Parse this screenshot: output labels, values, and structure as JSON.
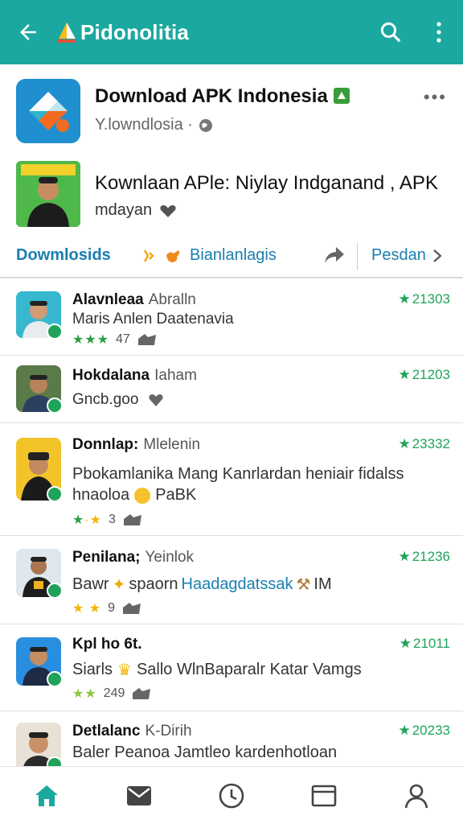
{
  "appbar": {
    "title": "Pidonolitia",
    "back_icon": "arrow-left-icon",
    "search_icon": "search-icon",
    "more_icon": "more-vertical-icon",
    "color": "#1ba8a0"
  },
  "app": {
    "name": "Download APK Indonesia",
    "developer": "Y.lowndlosia ·",
    "more": "•••"
  },
  "featured": {
    "title": "Kownlaan APle: Niylay Indganand , APK",
    "subtitle": "mdayan"
  },
  "tabs": {
    "downloads": "Dowmlosids",
    "middle": "Bianlanlagis",
    "right": "Pesdan"
  },
  "list": [
    {
      "name": "Alavnleaa",
      "sub": "Abralln",
      "score": "21303",
      "desc": "Maris Anlen Daatenavia",
      "rating": "47"
    },
    {
      "name": "Hokdalana",
      "sub": "Iaham",
      "score": "21203",
      "desc": "Gncb.goo",
      "rating": ""
    },
    {
      "name": "Donnlap:",
      "sub": "Mlelenin",
      "score": "23332",
      "desc": "Pbokamlanika Mang Kanrlardan heniair fidalss",
      "desc2": "hnaoloa",
      "desc2_suffix": "PaBK",
      "rating": "3"
    },
    {
      "name": "Penilana;",
      "sub": "Yeinlok",
      "score": "21236",
      "desc_a": "Bawr",
      "desc_b": "spaorn",
      "desc_c": "Haadagdatssak",
      "desc_d": "IM",
      "rating": "9"
    },
    {
      "name": "Kpl ho 6t.",
      "sub": "",
      "score": "21011",
      "desc": "Siarls",
      "desc_b": "Sallo WlnBaparalr Katar Vamgs",
      "rating": "249"
    },
    {
      "name": "Detlalanc",
      "sub": "K-Dirih",
      "score": "20233",
      "desc": "Baler Peanoa Jamtleo kardenhotloan",
      "rating": ""
    }
  ],
  "nav": [
    "home-icon",
    "mail-icon",
    "clock-icon",
    "browser-window-icon",
    "profile-icon"
  ]
}
